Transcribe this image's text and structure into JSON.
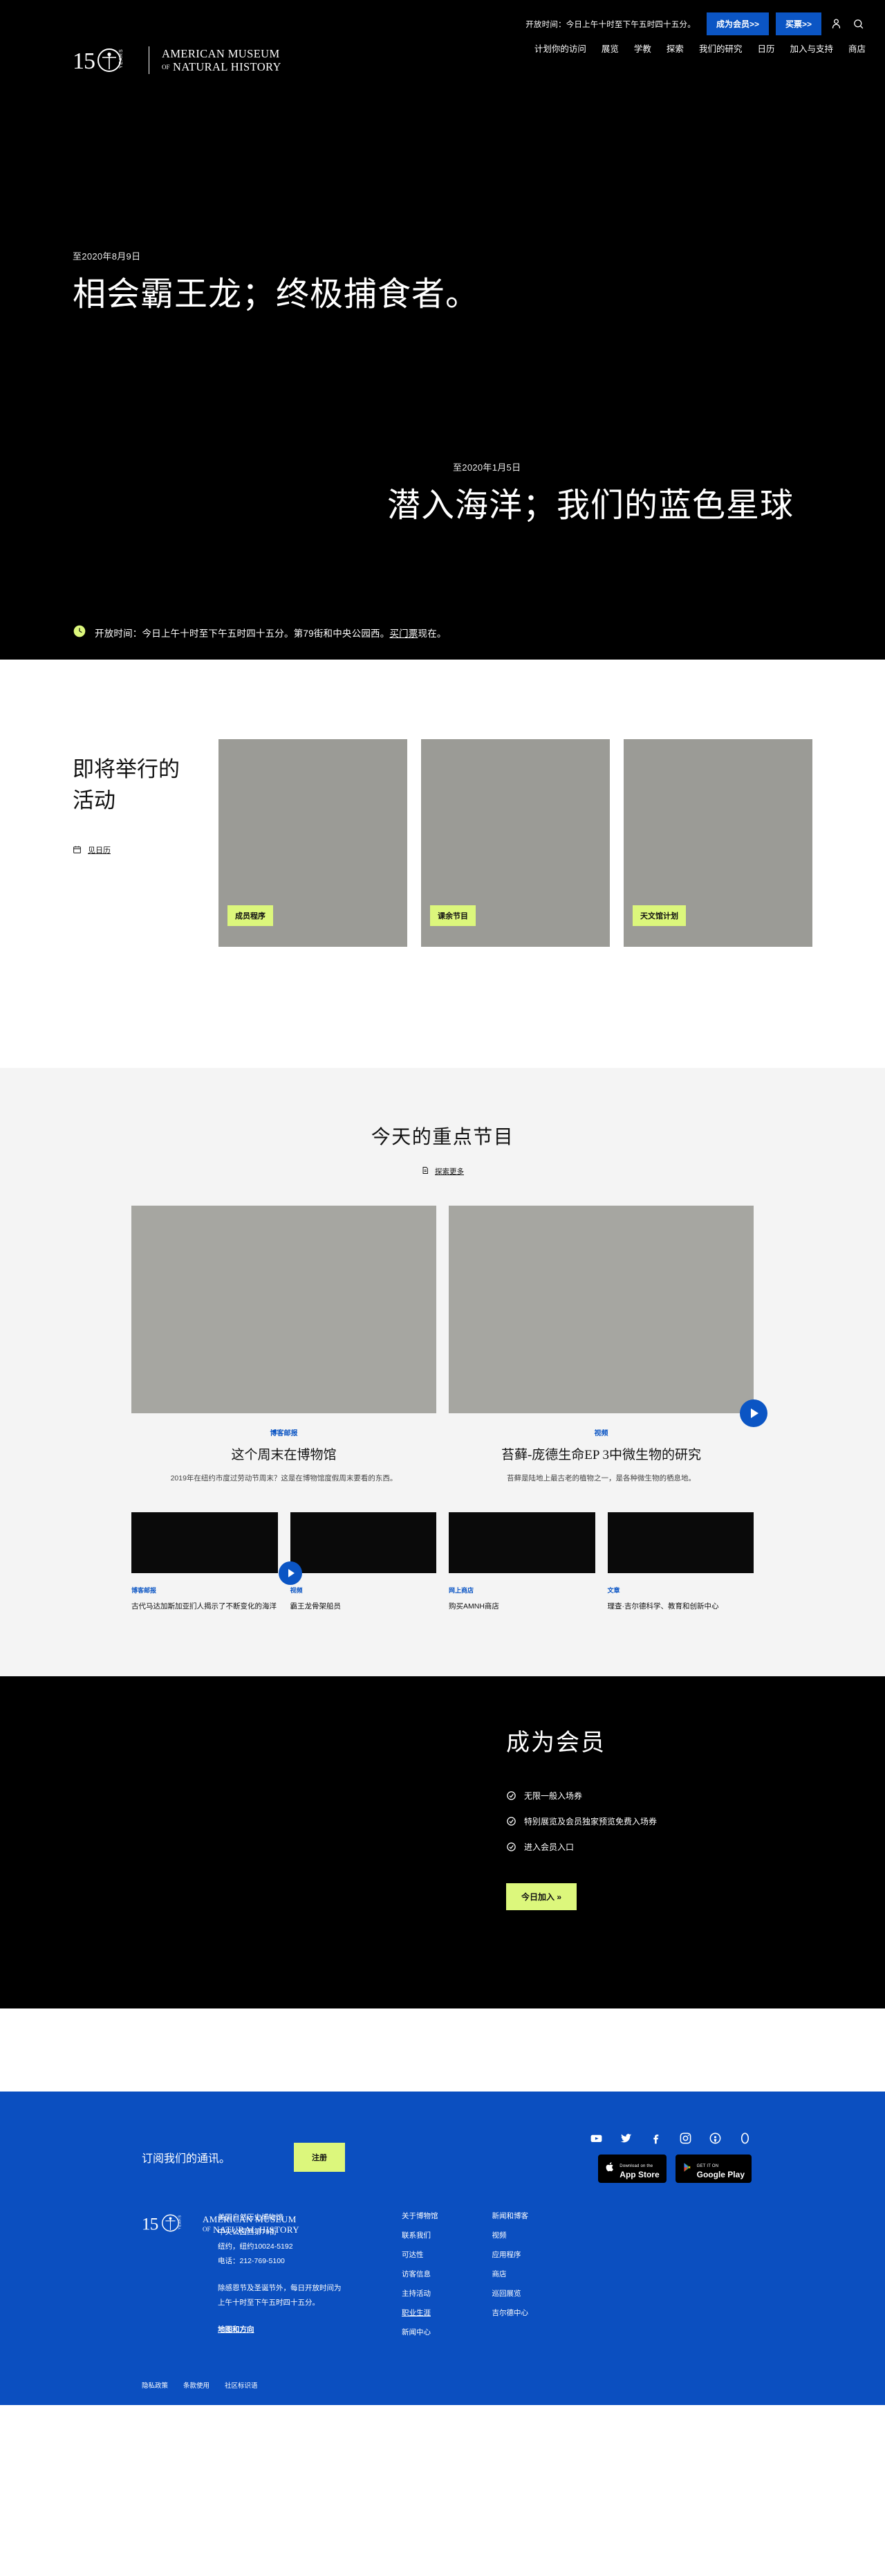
{
  "brand": {
    "anniversary": "150",
    "years_label": "YEARS",
    "line1": "AMERICAN MUSEUM",
    "line2_of": "OF",
    "line2": "NATURAL HISTORY"
  },
  "header": {
    "hours_note": "开放时间：今日上午十时至下午五时四十五分。",
    "member_button": "成为会员>>",
    "tickets_button": "买票>>",
    "account_icon": "user-icon",
    "search_icon": "search-icon",
    "nav": [
      {
        "label": "计划你的访问"
      },
      {
        "label": "展览"
      },
      {
        "label": "学教"
      },
      {
        "label": "探索"
      },
      {
        "label": "我们的研究"
      },
      {
        "label": "日历"
      },
      {
        "label": "加入与支持"
      },
      {
        "label": "商店"
      }
    ]
  },
  "hero": {
    "slides": [
      {
        "kicker": "至2020年8月9日",
        "title": "相会霸王龙；终极捕食者。"
      },
      {
        "kicker": "至2020年1月5日",
        "title": "潜入海洋；我们的蓝色星球"
      }
    ],
    "hours_bar": {
      "icon": "clock-icon",
      "text_before": "开放时间：今日上午十时至下午五时四十五分。第79街和中央公园西。",
      "link_text": "买门票",
      "text_after": "现在。"
    }
  },
  "events": {
    "heading": "即将举行的活动",
    "calendar_link": "见日历",
    "calendar_icon": "calendar-icon",
    "cards": [
      {
        "tag": "成员程序"
      },
      {
        "tag": "课余节目"
      },
      {
        "tag": "天文馆计划"
      }
    ]
  },
  "today": {
    "heading": "今天的重点节目",
    "explore_link": "探索更多",
    "explore_icon": "document-icon",
    "features": [
      {
        "eyebrow": "博客邮报",
        "title": "这个周末在博物馆",
        "desc": "2019年在纽约市度过劳动节周末？这是在博物馆度假周末要看的东西。",
        "has_play": false
      },
      {
        "eyebrow": "视频",
        "title": "苔藓-庞德生命EP 3中微生物的研究",
        "desc": "苔藓是陆地上最古老的植物之一，是各种微生物的栖息地。",
        "has_play": true
      }
    ],
    "small_cards": [
      {
        "eyebrow": "博客邮报",
        "title": "古代马达加斯加亚扪人揭示了不断变化的海洋",
        "has_play": false
      },
      {
        "eyebrow": "视频",
        "title": "霸王龙骨架船员",
        "has_play": true
      },
      {
        "eyebrow": "网上商店",
        "title": "购买AMNH商店",
        "has_play": false
      },
      {
        "eyebrow": "文章",
        "title": "理查·吉尔德科学、教育和创新中心",
        "has_play": false
      }
    ]
  },
  "membership": {
    "heading": "成为会员",
    "benefits": [
      "无限一般入场券",
      "特别展览及会员独家预览免费入场券",
      "进入会员入口"
    ],
    "join_button": "今日加入 »",
    "check_icon": "check-circle-icon"
  },
  "footer": {
    "newsletter_label": "订阅我们的通讯。",
    "signup_button": "注册",
    "social": [
      {
        "name": "youtube-icon"
      },
      {
        "name": "twitter-icon"
      },
      {
        "name": "facebook-icon"
      },
      {
        "name": "instagram-icon"
      },
      {
        "name": "podcast-icon"
      },
      {
        "name": "tumblr-icon"
      }
    ],
    "app_store": {
      "small": "Download on the",
      "big": "App Store"
    },
    "google_play": {
      "small": "GET IT ON",
      "big": "Google Play"
    },
    "address": {
      "line1": "美国自然历史博物馆",
      "line2": "中央公园西第79街",
      "line3": "纽约，纽约10024-5192",
      "line4": "电话：212-769-5100",
      "hours1": "除感恩节及圣诞节外，每日开放时间为",
      "hours2": "上午十时至下午五时四十五分。",
      "directions": "地图和方向"
    },
    "columns": [
      {
        "links": [
          {
            "label": "关于博物馆",
            "underline": false
          },
          {
            "label": "联系我们",
            "underline": false
          },
          {
            "label": "可达性",
            "underline": false
          },
          {
            "label": "访客信息",
            "underline": false
          },
          {
            "label": "主持活动",
            "underline": false
          },
          {
            "label": "职业生涯",
            "underline": true
          },
          {
            "label": "新闻中心",
            "underline": false
          }
        ]
      },
      {
        "links": [
          {
            "label": "新闻和博客",
            "underline": false
          },
          {
            "label": "视频",
            "underline": false
          },
          {
            "label": "应用程序",
            "underline": false
          },
          {
            "label": "商店",
            "underline": false
          },
          {
            "label": "巡回展览",
            "underline": false
          },
          {
            "label": "吉尔德中心",
            "underline": false
          }
        ]
      }
    ],
    "bottom_links": [
      {
        "label": "隐私政策"
      },
      {
        "label": "条款使用"
      },
      {
        "label": "社区标识语"
      }
    ]
  },
  "colors": {
    "brand_blue": "#0b55c4",
    "footer_blue": "#0b4fc0",
    "accent_yellow": "#dcf77c",
    "black": "#000000",
    "grey_placeholder": "#9b9b96"
  }
}
